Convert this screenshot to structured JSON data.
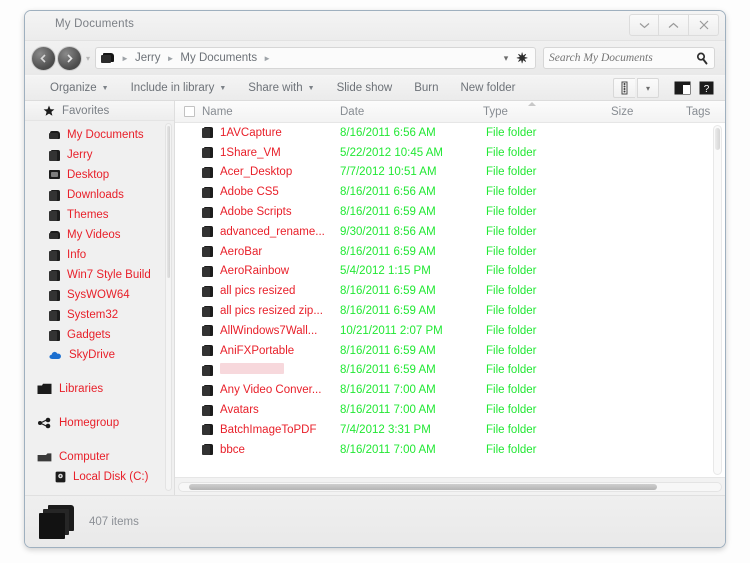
{
  "window": {
    "title": "My Documents",
    "controls": [
      {
        "name": "minimize",
        "glyph": "chevron-down"
      },
      {
        "name": "maximize",
        "glyph": "chevron-up"
      },
      {
        "name": "close",
        "glyph": "close"
      }
    ]
  },
  "nav": {
    "back_label": "Back",
    "forward_label": "Forward",
    "history_dropdown": "▾",
    "breadcrumb": [
      "Jerry",
      "My Documents"
    ],
    "breadcrumb_separator": "►",
    "address_dropdown": "▾",
    "refresh_glyph": "✷"
  },
  "search": {
    "placeholder": "Search My Documents",
    "value": "",
    "icon": "search-icon"
  },
  "toolbar": {
    "items": [
      {
        "label": "Organize",
        "caret": true
      },
      {
        "label": "Include in library",
        "caret": true
      },
      {
        "label": "Share with",
        "caret": true
      },
      {
        "label": "Slide show",
        "caret": false
      },
      {
        "label": "Burn",
        "caret": false
      },
      {
        "label": "New folder",
        "caret": false
      }
    ],
    "view_button": "views-icon",
    "view_dropdown": "▾",
    "preview_pane_button": "preview-pane-icon",
    "help_button": "help-icon"
  },
  "sidebar": {
    "favorites_header": "Favorites",
    "favorites": [
      {
        "label": "My Documents",
        "icon": "folder-open-icon"
      },
      {
        "label": "Jerry",
        "icon": "folder-icon"
      },
      {
        "label": "Desktop",
        "icon": "desktop-icon"
      },
      {
        "label": "Downloads",
        "icon": "folder-download-icon"
      },
      {
        "label": "Themes",
        "icon": "folder-icon"
      },
      {
        "label": "My Videos",
        "icon": "folder-open-icon"
      },
      {
        "label": "Info",
        "icon": "folder-icon"
      },
      {
        "label": "Win7 Style Build",
        "icon": "folder-icon"
      },
      {
        "label": "SysWOW64",
        "icon": "folder-icon"
      },
      {
        "label": "System32",
        "icon": "folder-icon"
      },
      {
        "label": "Gadgets",
        "icon": "folder-icon"
      },
      {
        "label": "SkyDrive",
        "icon": "cloud-icon"
      }
    ],
    "groups": [
      {
        "label": "Libraries",
        "icon": "libraries-icon"
      },
      {
        "label": "Homegroup",
        "icon": "homegroup-icon"
      },
      {
        "label": "Computer",
        "icon": "computer-icon"
      }
    ],
    "computer_children": [
      {
        "label": "Local Disk (C:)",
        "icon": "drive-icon"
      }
    ]
  },
  "filelist": {
    "columns": [
      "Name",
      "Date",
      "Type",
      "Size",
      "Tags"
    ],
    "select_all_checkbox": false,
    "rows": [
      {
        "name": "1AVCapture",
        "date": "8/16/2011 6:56 AM",
        "type": "File folder",
        "size": "",
        "tags": ""
      },
      {
        "name": "1Share_VM",
        "date": "5/22/2012 10:45 AM",
        "type": "File folder",
        "size": "",
        "tags": ""
      },
      {
        "name": "Acer_Desktop",
        "date": "7/7/2012 10:51 AM",
        "type": "File folder",
        "size": "",
        "tags": ""
      },
      {
        "name": "Adobe CS5",
        "date": "8/16/2011 6:56 AM",
        "type": "File folder",
        "size": "",
        "tags": ""
      },
      {
        "name": "Adobe Scripts",
        "date": "8/16/2011 6:59 AM",
        "type": "File folder",
        "size": "",
        "tags": ""
      },
      {
        "name": "advanced_rename...",
        "date": "9/30/2011 8:56 AM",
        "type": "File folder",
        "size": "",
        "tags": ""
      },
      {
        "name": "AeroBar",
        "date": "8/16/2011 6:59 AM",
        "type": "File folder",
        "size": "",
        "tags": ""
      },
      {
        "name": "AeroRainbow",
        "date": "5/4/2012 1:15 PM",
        "type": "File folder",
        "size": "",
        "tags": ""
      },
      {
        "name": "all pics resized",
        "date": "8/16/2011 6:59 AM",
        "type": "File folder",
        "size": "",
        "tags": ""
      },
      {
        "name": "all pics resized zip...",
        "date": "8/16/2011 6:59 AM",
        "type": "File folder",
        "size": "",
        "tags": ""
      },
      {
        "name": "AllWindows7Wall...",
        "date": "10/21/2011 2:07 PM",
        "type": "File folder",
        "size": "",
        "tags": ""
      },
      {
        "name": "AniFXPortable",
        "date": "8/16/2011 6:59 AM",
        "type": "File folder",
        "size": "",
        "tags": ""
      },
      {
        "name": "",
        "date": "8/16/2011 6:59 AM",
        "type": "File folder",
        "size": "",
        "tags": "",
        "redacted": true
      },
      {
        "name": "Any Video Conver...",
        "date": "8/16/2011 7:00 AM",
        "type": "File folder",
        "size": "",
        "tags": ""
      },
      {
        "name": "Avatars",
        "date": "8/16/2011 7:00 AM",
        "type": "File folder",
        "size": "",
        "tags": ""
      },
      {
        "name": "BatchImageToPDF",
        "date": "7/4/2012 3:31 PM",
        "type": "File folder",
        "size": "",
        "tags": ""
      },
      {
        "name": "bbce",
        "date": "8/16/2011 7:00 AM",
        "type": "File folder",
        "size": "",
        "tags": ""
      }
    ]
  },
  "statusbar": {
    "item_count": "407 items"
  },
  "colors": {
    "filename_red": "#e8202a",
    "value_green": "#22e834",
    "chrome_grey": "#efefef",
    "label_grey": "#6d7278",
    "skydrive_blue": "#1b6fd0"
  }
}
